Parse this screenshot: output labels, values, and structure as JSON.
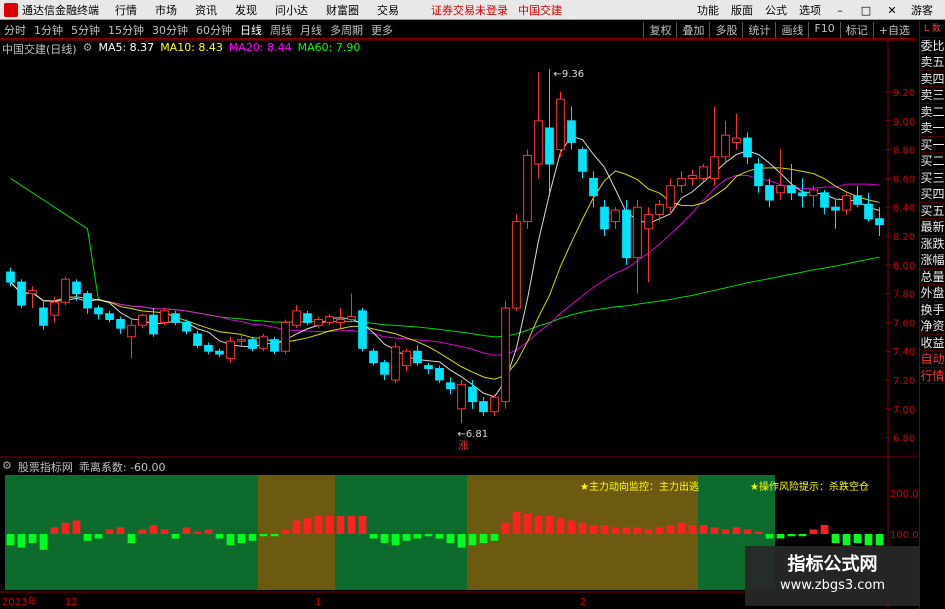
{
  "menubar": {
    "app_name": "通达信金融终端",
    "items": [
      "行情",
      "市场",
      "资讯",
      "发现",
      "问小达",
      "财富圈",
      "交易"
    ],
    "notice": "证券交易未登录",
    "stock": "中国交建",
    "right_items": [
      "功能",
      "版面",
      "公式",
      "选项"
    ],
    "guest": "游客"
  },
  "toolbar": {
    "periods": [
      "分时",
      "1分钟",
      "5分钟",
      "15分钟",
      "30分钟",
      "60分钟",
      "日线",
      "周线",
      "月线",
      "多周期",
      "更多"
    ],
    "active": "日线",
    "right": [
      "复权",
      "叠加",
      "多股",
      "统计",
      "画线",
      "F10",
      "标记",
      "+自选"
    ]
  },
  "titleline": {
    "name": "中国交建(日线)",
    "ma5": "MA5: 8.37",
    "ma10": "MA10: 8.43",
    "ma20": "MA20: 8.44",
    "ma60": "MA60: 7.90"
  },
  "colors": {
    "up": "#ff3232",
    "down": "#00e4ff",
    "ma5": "#ffffff",
    "ma10": "#ffff00",
    "ma20": "#ff00ff",
    "ma60": "#00ff00",
    "grid": "#800000"
  },
  "sidebar": {
    "items": [
      "委比",
      "卖五",
      "卖四",
      "卖三",
      "卖二",
      "卖一",
      "买一",
      "买二",
      "买三",
      "买四",
      "买五",
      "最新",
      "涨跌",
      "涨幅",
      "总量",
      "外盘",
      "换手",
      "净资",
      "收益",
      "自动",
      "行情"
    ],
    "top_label": "L 数"
  },
  "price_axis": {
    "ticks": [
      "9.20",
      "9.00",
      "8.80",
      "8.60",
      "8.40",
      "8.20",
      "8.00",
      "7.80",
      "7.60",
      "7.40",
      "7.20",
      "7.00",
      "6.80"
    ]
  },
  "annotations": {
    "high": "9.36",
    "low": "6.81",
    "low_tag": "涨"
  },
  "indicator": {
    "name": "股票指标网",
    "label": "乖离系数: -60.00",
    "note1": "★主力动向监控：主力出逃",
    "note2": "★操作风险提示：杀跌空仓",
    "ticks": [
      "200.0",
      "100.0"
    ]
  },
  "date_axis": {
    "labels": [
      "2023年",
      "12",
      "1",
      "2"
    ]
  },
  "watermark": {
    "line1": "指标公式网",
    "line2": "www.zbgs3.com"
  },
  "chart_data": {
    "type": "candlestick",
    "ohlc": [
      [
        7.95,
        7.98,
        7.85,
        7.88
      ],
      [
        7.88,
        7.9,
        7.7,
        7.72
      ],
      [
        7.8,
        7.85,
        7.7,
        7.82
      ],
      [
        7.7,
        7.75,
        7.55,
        7.58
      ],
      [
        7.65,
        7.78,
        7.6,
        7.74
      ],
      [
        7.74,
        7.92,
        7.72,
        7.9
      ],
      [
        7.88,
        7.9,
        7.75,
        7.8
      ],
      [
        7.8,
        7.82,
        7.66,
        7.7
      ],
      [
        7.7,
        7.72,
        7.62,
        7.66
      ],
      [
        7.66,
        7.68,
        7.6,
        7.62
      ],
      [
        7.62,
        7.64,
        7.52,
        7.56
      ],
      [
        7.5,
        7.62,
        7.35,
        7.58
      ],
      [
        7.58,
        7.66,
        7.56,
        7.65
      ],
      [
        7.65,
        7.7,
        7.5,
        7.52
      ],
      [
        7.6,
        7.7,
        7.58,
        7.68
      ],
      [
        7.66,
        7.68,
        7.58,
        7.6
      ],
      [
        7.6,
        7.62,
        7.52,
        7.54
      ],
      [
        7.52,
        7.54,
        7.42,
        7.44
      ],
      [
        7.44,
        7.46,
        7.38,
        7.4
      ],
      [
        7.4,
        7.42,
        7.36,
        7.38
      ],
      [
        7.35,
        7.5,
        7.32,
        7.47
      ],
      [
        7.47,
        7.52,
        7.44,
        7.48
      ],
      [
        7.48,
        7.5,
        7.4,
        7.42
      ],
      [
        7.42,
        7.52,
        7.4,
        7.5
      ],
      [
        7.48,
        7.5,
        7.38,
        7.4
      ],
      [
        7.4,
        7.62,
        7.38,
        7.6
      ],
      [
        7.58,
        7.72,
        7.56,
        7.68
      ],
      [
        7.66,
        7.68,
        7.58,
        7.6
      ],
      [
        7.58,
        7.64,
        7.56,
        7.62
      ],
      [
        7.6,
        7.66,
        7.58,
        7.64
      ],
      [
        7.6,
        7.7,
        7.56,
        7.62
      ],
      [
        7.62,
        7.8,
        7.6,
        7.64
      ],
      [
        7.68,
        7.7,
        7.4,
        7.42
      ],
      [
        7.4,
        7.42,
        7.3,
        7.32
      ],
      [
        7.32,
        7.34,
        7.2,
        7.24
      ],
      [
        7.2,
        7.46,
        7.18,
        7.43
      ],
      [
        7.3,
        7.42,
        7.26,
        7.4
      ],
      [
        7.4,
        7.44,
        7.3,
        7.32
      ],
      [
        7.3,
        7.32,
        7.24,
        7.28
      ],
      [
        7.28,
        7.3,
        7.18,
        7.2
      ],
      [
        7.18,
        7.22,
        7.1,
        7.14
      ],
      [
        7.0,
        7.2,
        6.9,
        7.17
      ],
      [
        7.15,
        7.2,
        7.0,
        7.05
      ],
      [
        7.05,
        7.08,
        6.95,
        6.98
      ],
      [
        6.98,
        7.1,
        6.95,
        7.08
      ],
      [
        7.05,
        7.75,
        7.0,
        7.7
      ],
      [
        7.7,
        8.35,
        7.68,
        8.3
      ],
      [
        8.3,
        8.8,
        8.25,
        8.76
      ],
      [
        8.7,
        9.34,
        8.6,
        9.0
      ],
      [
        8.95,
        9.36,
        8.5,
        8.7
      ],
      [
        8.8,
        9.2,
        8.75,
        9.15
      ],
      [
        9.0,
        9.1,
        8.8,
        8.85
      ],
      [
        8.8,
        8.82,
        8.6,
        8.65
      ],
      [
        8.6,
        8.65,
        8.4,
        8.48
      ],
      [
        8.4,
        8.45,
        8.2,
        8.25
      ],
      [
        8.3,
        8.4,
        8.25,
        8.38
      ],
      [
        8.38,
        8.45,
        8.0,
        8.05
      ],
      [
        8.05,
        8.45,
        7.8,
        8.4
      ],
      [
        8.25,
        8.4,
        7.88,
        8.35
      ],
      [
        8.35,
        8.45,
        8.3,
        8.42
      ],
      [
        8.4,
        8.6,
        8.35,
        8.55
      ],
      [
        8.55,
        8.65,
        8.5,
        8.6
      ],
      [
        8.6,
        8.66,
        8.55,
        8.62
      ],
      [
        8.6,
        8.7,
        8.58,
        8.68
      ],
      [
        8.6,
        9.1,
        8.55,
        8.75
      ],
      [
        8.75,
        9.0,
        8.7,
        8.9
      ],
      [
        8.85,
        9.05,
        8.8,
        8.88
      ],
      [
        8.88,
        8.92,
        8.7,
        8.75
      ],
      [
        8.7,
        8.74,
        8.5,
        8.55
      ],
      [
        8.55,
        8.6,
        8.4,
        8.45
      ],
      [
        8.5,
        8.8,
        8.45,
        8.55
      ],
      [
        8.55,
        8.7,
        8.45,
        8.5
      ],
      [
        8.5,
        8.6,
        8.4,
        8.48
      ],
      [
        8.48,
        8.55,
        8.4,
        8.52
      ],
      [
        8.5,
        8.52,
        8.35,
        8.4
      ],
      [
        8.4,
        8.45,
        8.25,
        8.38
      ],
      [
        8.38,
        8.5,
        8.35,
        8.48
      ],
      [
        8.48,
        8.55,
        8.4,
        8.42
      ],
      [
        8.42,
        8.5,
        8.3,
        8.32
      ],
      [
        8.32,
        8.4,
        8.2,
        8.28
      ]
    ],
    "ma_series": [
      {
        "name": "MA5",
        "value": 8.37
      },
      {
        "name": "MA10",
        "value": 8.43
      },
      {
        "name": "MA20",
        "value": 8.44
      },
      {
        "name": "MA60",
        "value": 7.9
      }
    ],
    "ylim": [
      6.7,
      9.45
    ],
    "indicator_bars": [
      -25,
      -30,
      -20,
      -35,
      15,
      25,
      30,
      -15,
      -10,
      10,
      15,
      -20,
      10,
      20,
      10,
      -10,
      15,
      5,
      10,
      -10,
      -25,
      -20,
      -15,
      -5,
      -5,
      10,
      30,
      35,
      40,
      40,
      40,
      40,
      40,
      -10,
      -20,
      -25,
      -15,
      -10,
      -5,
      -10,
      -20,
      -30,
      -25,
      -20,
      -15,
      25,
      50,
      45,
      40,
      40,
      35,
      30,
      25,
      20,
      20,
      15,
      15,
      15,
      10,
      15,
      20,
      25,
      20,
      20,
      15,
      10,
      15,
      10,
      5,
      -10,
      -10,
      -5,
      -5,
      10,
      20,
      -20,
      -25,
      -20,
      -25,
      -25
    ],
    "zones": [
      {
        "start": 0,
        "end": 23,
        "color": "green"
      },
      {
        "start": 23,
        "end": 30,
        "color": "olive"
      },
      {
        "start": 30,
        "end": 42,
        "color": "green"
      },
      {
        "start": 42,
        "end": 63,
        "color": "olive"
      },
      {
        "start": 63,
        "end": 70,
        "color": "green"
      }
    ]
  }
}
